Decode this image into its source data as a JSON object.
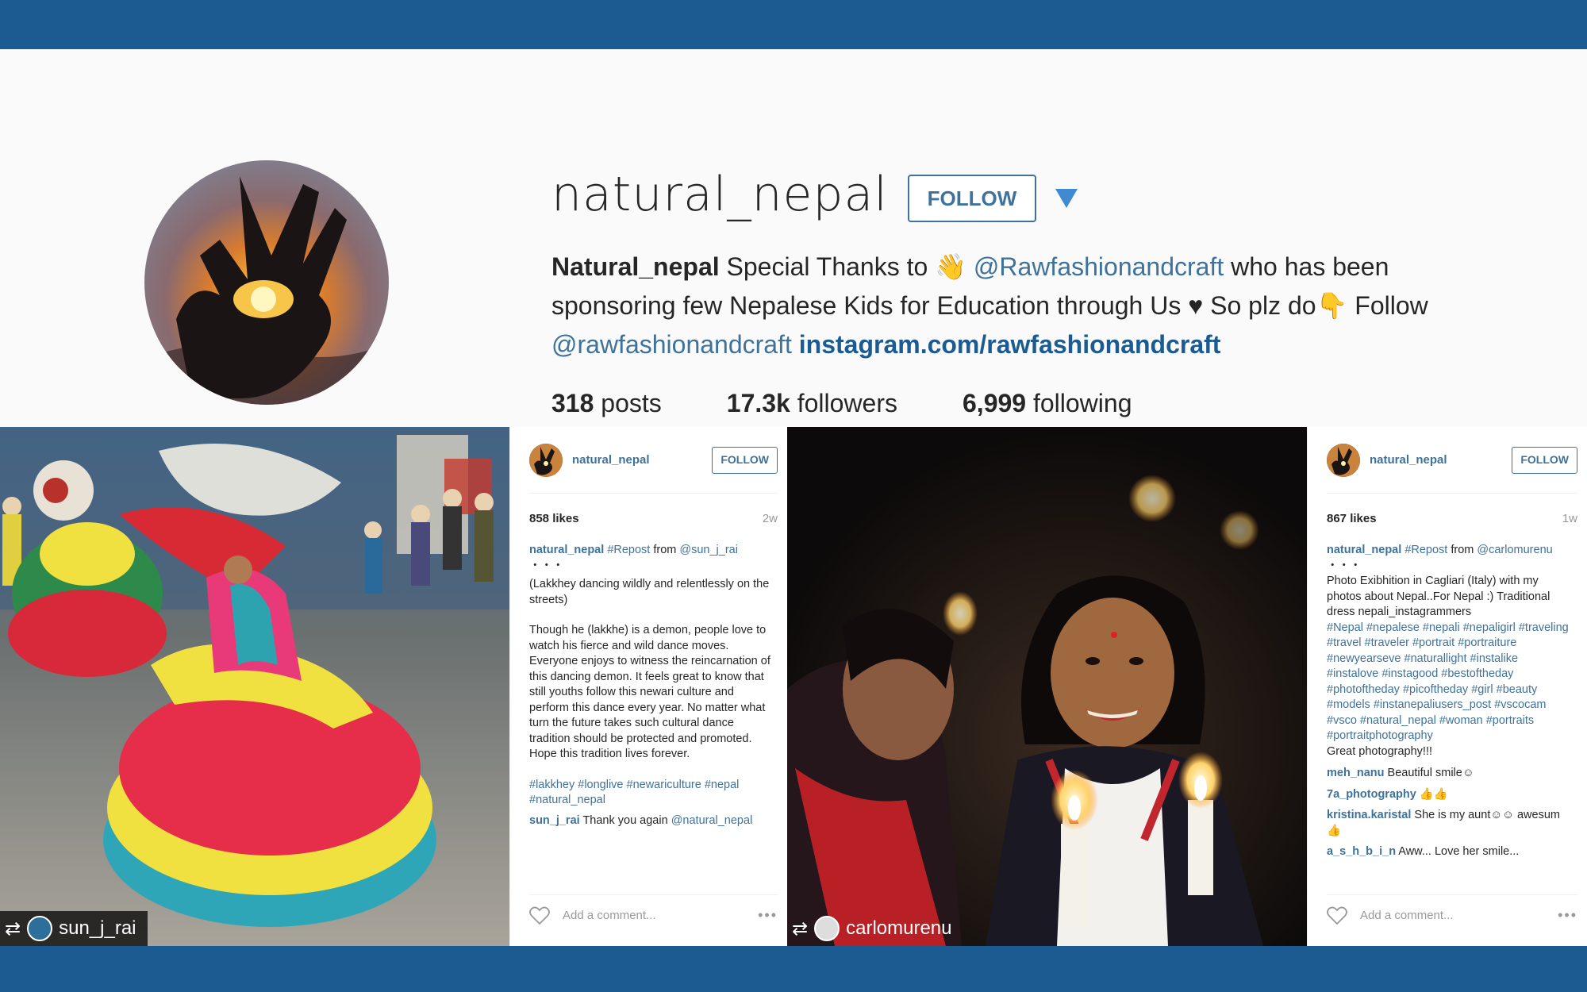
{
  "profile": {
    "username": "natural_nepal",
    "follow_label": "FOLLOW",
    "bio_name": "Natural_nepal",
    "bio_text_1": " Special Thanks to ",
    "bio_emoji_1": "👋",
    "bio_mention_1": "@Rawfashionandcraft",
    "bio_text_2": " who has been sponsoring few Nepalese Kids for Education through Us ",
    "bio_heart": "♥",
    "bio_text_3": " So plz do",
    "bio_emoji_2": "👇",
    "bio_text_4": " Follow ",
    "bio_mention_2": "@rawfashionandcraft",
    "bio_link": "instagram.com/rawfashionandcraft",
    "stats": {
      "posts_count": "318",
      "posts_label": "posts",
      "followers_count": "17.3k",
      "followers_label": "followers",
      "following_count": "6,999",
      "following_label": "following"
    }
  },
  "post1": {
    "repost_user": "sun_j_rai",
    "user": "natural_nepal",
    "follow_label": "FOLLOW",
    "likes": "858 likes",
    "ago": "2w",
    "caption_user": "natural_nepal",
    "caption_tag": "#Repost",
    "caption_from": " from ",
    "caption_mention": "@sun_j_rai",
    "caption_dots": "・・・",
    "caption_p1": "(Lakkhey dancing wildly and relentlessly on the streets)",
    "caption_p2": "Though he (lakkhe) is a demon, people love to watch his fierce and wild dance moves. Everyone enjoys to witness the reincarnation of this dancing demon. It feels great to know that still youths follow this newari culture and perform this dance every year. No matter what turn the future takes such cultural dance tradition should be protected and promoted. Hope this tradition lives forever.",
    "caption_tags": "#lakkhey #longlive #newariculture #nepal #natural_nepal",
    "comment_user": "sun_j_rai",
    "comment_text": " Thank you again ",
    "comment_mention": "@natural_nepal",
    "add_comment": "Add a comment...",
    "more": "•••"
  },
  "post2": {
    "repost_user": "carlomurenu",
    "user": "natural_nepal",
    "follow_label": "FOLLOW",
    "likes": "867 likes",
    "ago": "1w",
    "caption_user": "natural_nepal",
    "caption_tag": "#Repost",
    "caption_from": " from ",
    "caption_mention": "@carlomurenu",
    "caption_dots": " ・・・",
    "caption_text": "Photo Exibhition in Cagliari (Italy) with my photos about Nepal..For Nepal :) Traditional dress nepali_instagrammers",
    "caption_tags": "#Nepal #nepalese #nepali #nepaligirl #traveling #travel #traveler #portrait #portraiture #newyearseve #naturallight #instalike #instalove #instagood #bestoftheday #photoftheday #picoftheday #girl #beauty #models #instanepaliusers_post #vscocam #vsco #natural_nepal #woman #portraits #portraitphotography",
    "caption_end": "Great photography!!!",
    "comments": [
      {
        "user": "meh_nanu",
        "text": " Beautiful smile☺"
      },
      {
        "user": "7a_photography",
        "text": " 👍👍"
      },
      {
        "user": "kristina.karistal",
        "text": " She is my aunt☺☺ awesum👍"
      },
      {
        "user": "a_s_h_b_i_n",
        "text": " Aww... Love her smile..."
      }
    ],
    "add_comment": "Add a comment...",
    "more": "•••"
  },
  "colors": {
    "brand_blue": "#1c5a92",
    "link_blue": "#3f729b",
    "arrow_blue": "#3f8ad1"
  }
}
